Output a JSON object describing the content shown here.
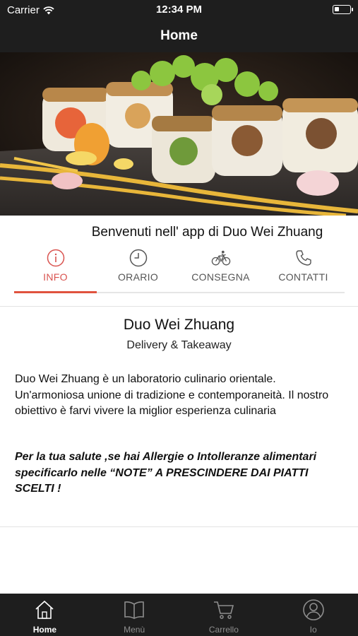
{
  "status_bar": {
    "carrier": "Carrier",
    "time": "12:34 PM"
  },
  "nav": {
    "title": "Home"
  },
  "welcome": "Benvenuti nell' app di Duo Wei Zhuang",
  "tabs": [
    {
      "label": "INFO",
      "icon": "info-icon",
      "active": true
    },
    {
      "label": "ORARIO",
      "icon": "clock-icon",
      "active": false
    },
    {
      "label": "CONSEGNA",
      "icon": "bicycle-icon",
      "active": false
    },
    {
      "label": "CONTATTI",
      "icon": "phone-icon",
      "active": false
    }
  ],
  "info": {
    "name": "Duo Wei Zhuang",
    "subtitle": "Delivery & Takeaway",
    "description": "Duo Wei Zhuang è un laboratorio culinario orientale. Un'armoniosa unione di tradizione e contemporaneità. Il nostro obiettivo è farvi vivere la miglior esperienza culinaria",
    "warning": "Per la tua salute ,se hai Allergie o Intolleranze alimentari specificarlo nelle “NOTE” A PRESCINDERE DAI PIATTI SCELTI !"
  },
  "bottom_tabs": [
    {
      "label": "Home",
      "icon": "home-icon",
      "active": true
    },
    {
      "label": "Menù",
      "icon": "book-icon",
      "active": false
    },
    {
      "label": "Carrello",
      "icon": "cart-icon",
      "active": false
    },
    {
      "label": "Io",
      "icon": "user-icon",
      "active": false
    }
  ],
  "colors": {
    "accent": "#e0533e",
    "bar_background": "#1e1e1e",
    "inactive_tab": "#8e8e8e"
  }
}
